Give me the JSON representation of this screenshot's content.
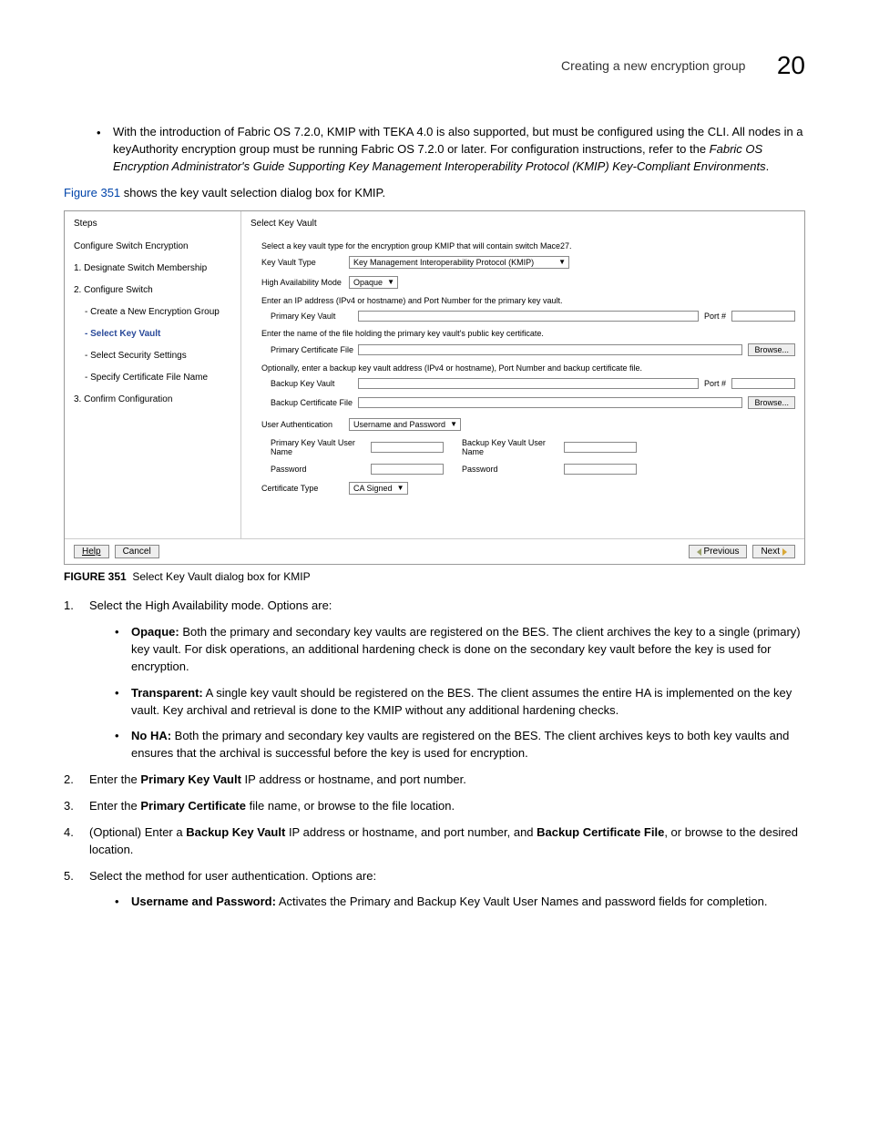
{
  "header": {
    "title": "Creating a new encryption group",
    "chapter": "20"
  },
  "intro_bullet": {
    "part1": "With the introduction of Fabric OS 7.2.0, KMIP with TEKA 4.0 is also supported, but must be configured using the CLI. All nodes in a keyAuthority encryption group must be running Fabric OS 7.2.0 or later. For configuration instructions, refer to the ",
    "italic": "Fabric OS Encryption Administrator's Guide Supporting Key Management Interoperability Protocol (KMIP) Key-Compliant Environments",
    "part2": "."
  },
  "figref_line": {
    "link": "Figure 351",
    "rest": " shows the key vault selection dialog box for KMIP."
  },
  "dialog": {
    "left": {
      "heading": "Steps",
      "row1": "Configure Switch Encryption",
      "s1": "1. Designate Switch Membership",
      "s2": "2. Configure Switch",
      "s2a": "- Create a New Encryption Group",
      "s2b": "- Select Key Vault",
      "s2c": "- Select Security Settings",
      "s2d": "- Specify Certificate File Name",
      "s3": "3. Confirm Configuration"
    },
    "right": {
      "heading": "Select Key Vault",
      "intro": "Select a key vault type for the encryption group KMIP that will contain switch Mace27.",
      "kvtype_lbl": "Key Vault Type",
      "kvtype_val": "Key Management Interoperability Protocol (KMIP)",
      "ha_lbl": "High Availability Mode",
      "ha_val": "Opaque",
      "primary_note": "Enter an IP address (IPv4 or hostname) and Port Number for the primary key vault.",
      "primary_kv_lbl": "Primary Key Vault",
      "port_lbl": "Port #",
      "cert_note": "Enter the name of the file holding the primary key vault's public key certificate.",
      "primary_cert_lbl": "Primary Certificate File",
      "browse": "Browse...",
      "backup_note": "Optionally, enter a backup key vault address (IPv4 or hostname), Port Number and backup certificate file.",
      "backup_kv_lbl": "Backup Key Vault",
      "backup_cert_lbl": "Backup Certificate File",
      "userauth_lbl": "User Authentication",
      "userauth_val": "Username and Password",
      "pkv_user_lbl": "Primary Key Vault User Name",
      "bkv_user_lbl": "Backup Key Vault User Name",
      "pwd_lbl": "Password",
      "certtype_lbl": "Certificate Type",
      "certtype_val": "CA Signed"
    },
    "foot": {
      "help": "Help",
      "cancel": "Cancel",
      "prev": "Previous",
      "next": "Next"
    }
  },
  "figcaption": {
    "label": "FIGURE 351",
    "text": "Select Key Vault dialog box for KMIP"
  },
  "steps": {
    "s1_txt": "Select the High Availability mode. Options are:",
    "s1a_b": "Opaque:",
    "s1a_t": " Both the primary and secondary key vaults are registered on the BES. The client archives the key to a single (primary) key vault. For disk operations, an additional hardening check is done on the secondary key vault before the key is used for encryption.",
    "s1b_b": "Transparent:",
    "s1b_t": " A single key vault should be registered on the BES. The client assumes the entire HA is implemented on the key vault. Key archival and retrieval is done to the KMIP without any additional hardening checks.",
    "s1c_b": "No HA:",
    "s1c_t": " Both the primary and secondary key vaults are registered on the BES. The client archives keys to both key vaults and ensures that the archival is successful before the key is used for encryption.",
    "s2_a": "Enter the ",
    "s2_b": "Primary Key Vault",
    "s2_c": " IP address or hostname, and port number.",
    "s3_a": "Enter the ",
    "s3_b": "Primary Certificate",
    "s3_c": " file name, or browse to the file location.",
    "s4_a": "(Optional) Enter a ",
    "s4_b": "Backup Key Vault",
    "s4_c": " IP address or hostname, and port number, and ",
    "s4_d": "Backup Certificate File",
    "s4_e": ", or browse to the desired location.",
    "s5_txt": "Select the method for user authentication. Options are:",
    "s5a_b": "Username and Password:",
    "s5a_t": " Activates the Primary and Backup Key Vault User Names and password fields for completion."
  }
}
